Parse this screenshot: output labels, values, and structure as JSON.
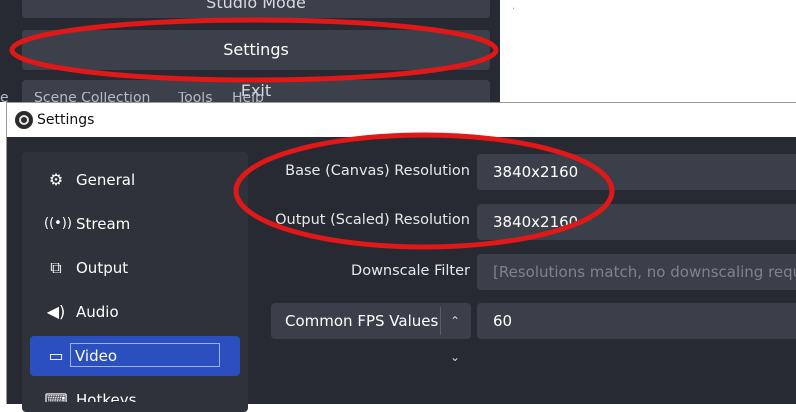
{
  "dock_menu": {
    "studio_mode_label": "Studio Mode",
    "settings_label": "Settings",
    "exit_label": "Exit"
  },
  "menubar": {
    "items": [
      "e",
      "Scene Collection",
      "Tools",
      "Help"
    ]
  },
  "window": {
    "title": "Settings"
  },
  "sidebar": {
    "items": [
      {
        "label": "General",
        "icon": "gear-icon"
      },
      {
        "label": "Stream",
        "icon": "antenna-icon"
      },
      {
        "label": "Output",
        "icon": "output-icon"
      },
      {
        "label": "Audio",
        "icon": "speaker-icon"
      },
      {
        "label": "Video",
        "icon": "monitor-icon",
        "active": true
      },
      {
        "label": "Hotkeys",
        "icon": "keyboard-icon"
      }
    ]
  },
  "video": {
    "base_label": "Base (Canvas) Resolution",
    "base_value": "3840x2160",
    "output_label": "Output (Scaled) Resolution",
    "output_value": "3840x2160",
    "downscale_label": "Downscale Filter",
    "downscale_value": "[Resolutions match, no downscaling required]",
    "fps_type": "Common FPS Values",
    "fps_value": "60"
  },
  "colors": {
    "window_bg": "#272a33",
    "sidebar_bg": "#2f323a",
    "active_item": "#2b4fbf",
    "field_bg": "#3b3f49",
    "annotation": "#e01818"
  }
}
